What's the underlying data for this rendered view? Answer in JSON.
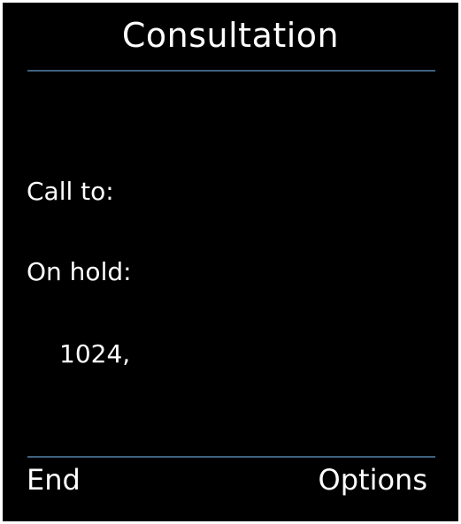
{
  "header": {
    "title": "Consultation"
  },
  "call": {
    "call_to_label": "Call to:",
    "on_hold_label": "On hold:",
    "on_hold_number": "1024,"
  },
  "softkeys": {
    "left_label": "End",
    "right_label": "Options"
  },
  "colors": {
    "background": "#000000",
    "text": "#ffffff",
    "divider": "#3f6180"
  }
}
